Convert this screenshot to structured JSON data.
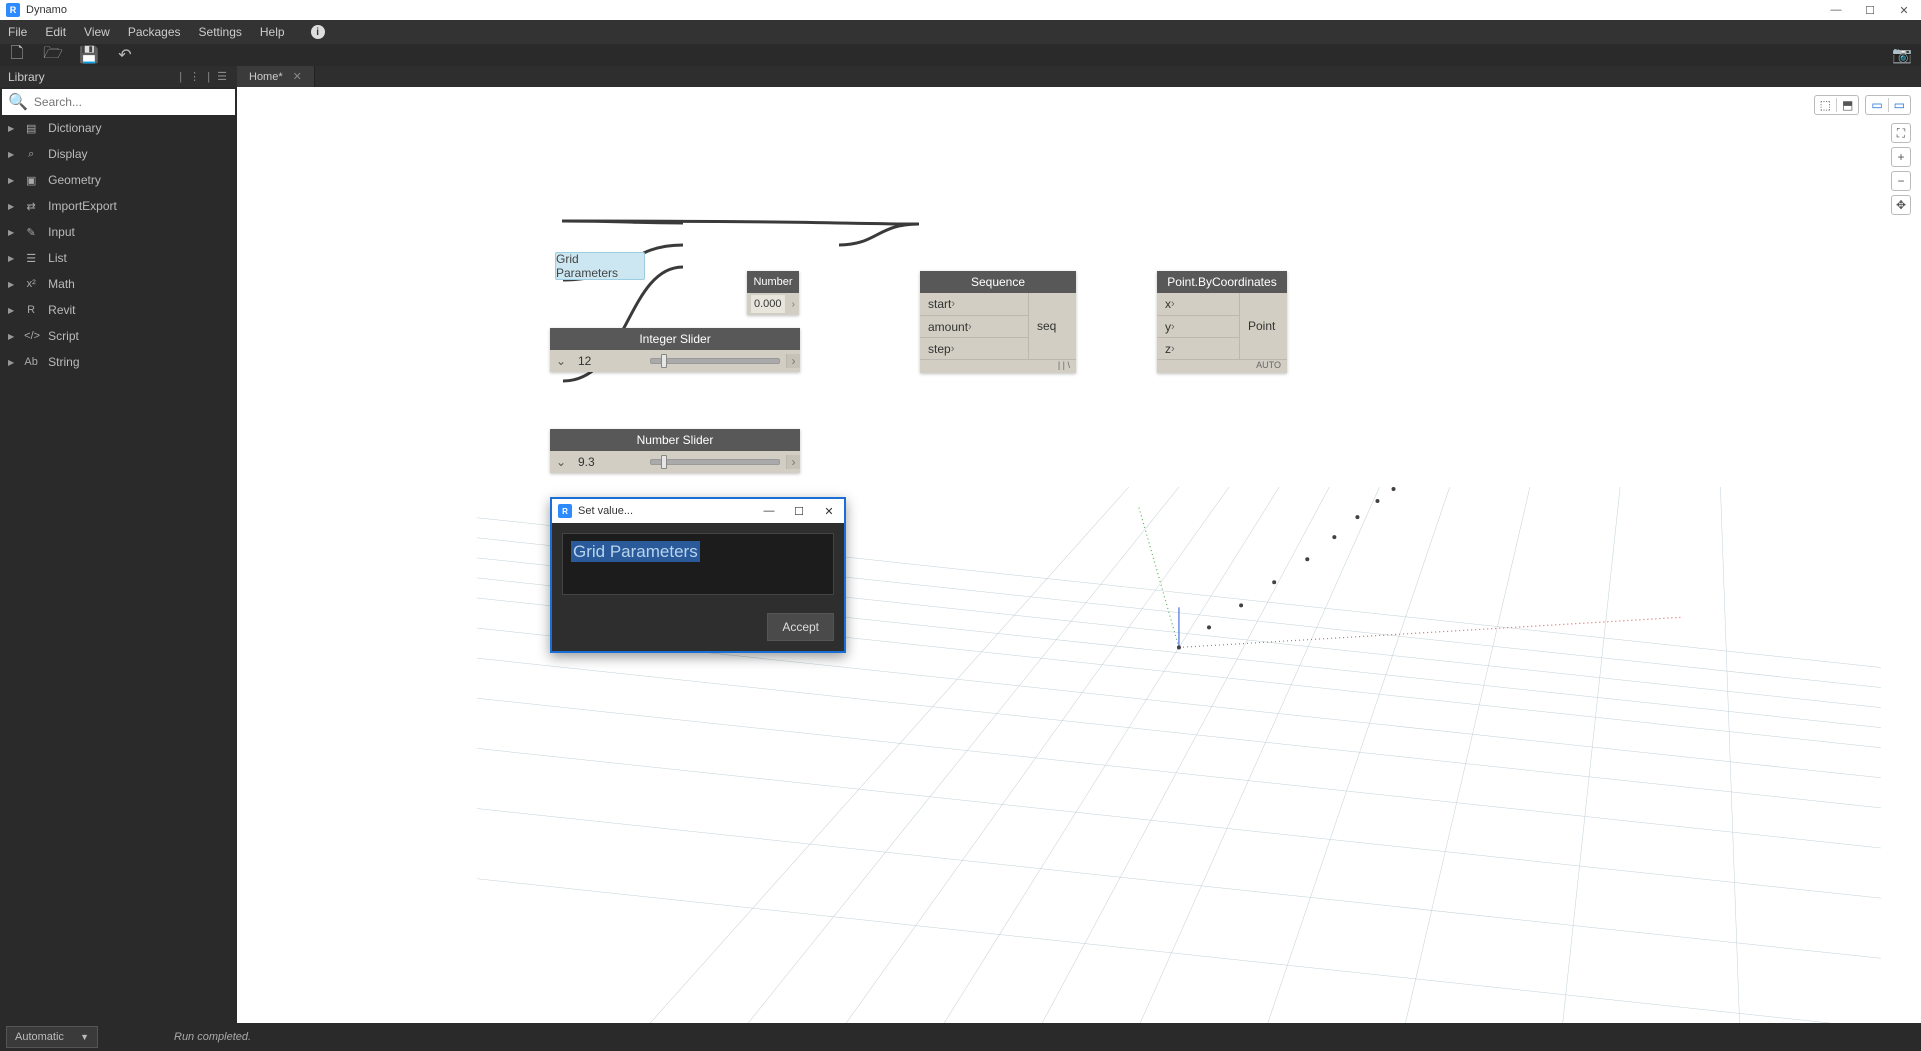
{
  "app": {
    "title": "Dynamo"
  },
  "menu": [
    "File",
    "Edit",
    "View",
    "Packages",
    "Settings",
    "Help"
  ],
  "sidebar": {
    "title": "Library",
    "search_placeholder": "Search...",
    "items": [
      {
        "icon": "▤",
        "label": "Dictionary"
      },
      {
        "icon": "⌕",
        "label": "Display"
      },
      {
        "icon": "▣",
        "label": "Geometry"
      },
      {
        "icon": "⇄",
        "label": "ImportExport"
      },
      {
        "icon": "✎",
        "label": "Input"
      },
      {
        "icon": "☰",
        "label": "List"
      },
      {
        "icon": "x²",
        "label": "Math"
      },
      {
        "icon": "R",
        "label": "Revit"
      },
      {
        "icon": "</>",
        "label": "Script"
      },
      {
        "icon": "Ab",
        "label": "String"
      }
    ]
  },
  "tabs": [
    {
      "label": "Home*"
    }
  ],
  "group_note": "Grid Parameters",
  "nodes": {
    "number": {
      "title": "Number",
      "value": "0.000"
    },
    "int_slider": {
      "title": "Integer Slider",
      "value": "12"
    },
    "num_slider": {
      "title": "Number Slider",
      "value": "9.3"
    },
    "sequence": {
      "title": "Sequence",
      "inputs": [
        "start",
        "amount",
        "step"
      ],
      "output": "seq",
      "lacing": "| | \\"
    },
    "point": {
      "title": "Point.ByCoordinates",
      "inputs": [
        "x",
        "y",
        "z"
      ],
      "output": "Point",
      "lacing": "AUTO"
    }
  },
  "dialog": {
    "title": "Set value...",
    "value": "Grid Parameters",
    "accept": "Accept"
  },
  "status": {
    "mode": "Automatic",
    "message": "Run completed."
  }
}
